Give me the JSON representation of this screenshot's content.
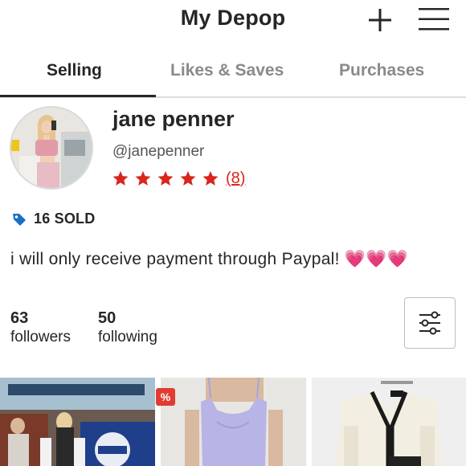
{
  "header": {
    "title": "My Depop"
  },
  "tabs": [
    {
      "label": "Selling",
      "active": true
    },
    {
      "label": "Likes & Saves",
      "active": false
    },
    {
      "label": "Purchases",
      "active": false
    }
  ],
  "profile": {
    "name": "jane penner",
    "handle": "@janepenner",
    "rating_stars": 5,
    "review_count": "(8)",
    "sold_label": "16 SOLD",
    "bio": "i will only receive payment through Paypal! 💗💗💗",
    "followers_count": "63",
    "followers_label": "followers",
    "following_count": "50",
    "following_label": "following"
  },
  "products": [
    {
      "discount_badge": ""
    },
    {
      "discount_badge": "%"
    },
    {
      "discount_badge": ""
    }
  ],
  "colors": {
    "star": "#d9261c",
    "tag_icon": "#1a6fc4",
    "discount": "#e03c31",
    "text": "#262626",
    "muted_tab": "#8a8a8a"
  },
  "icons": [
    "plus-icon",
    "hamburger-menu-icon",
    "price-tag-icon",
    "star-icon",
    "filter-sliders-icon"
  ]
}
